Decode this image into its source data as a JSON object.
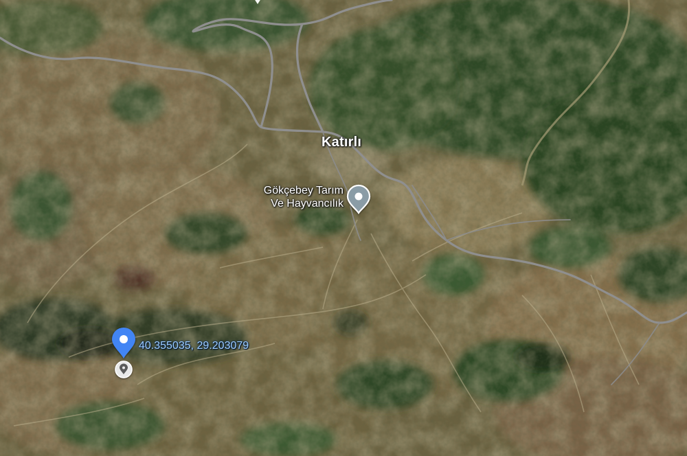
{
  "map": {
    "type": "satellite",
    "labels": {
      "town": "Katırlı",
      "poi_line1": "Gökçebey Tarım",
      "poi_line2": "Ve Hayvancılık",
      "dropped_pin_coordinates": "40.355035, 29.203079"
    },
    "colors": {
      "pin_blue": "#4285f4",
      "poi_marker": "#8a9ca6",
      "road": "#9a9a9a",
      "coordinate_text": "#9ccbff"
    }
  }
}
